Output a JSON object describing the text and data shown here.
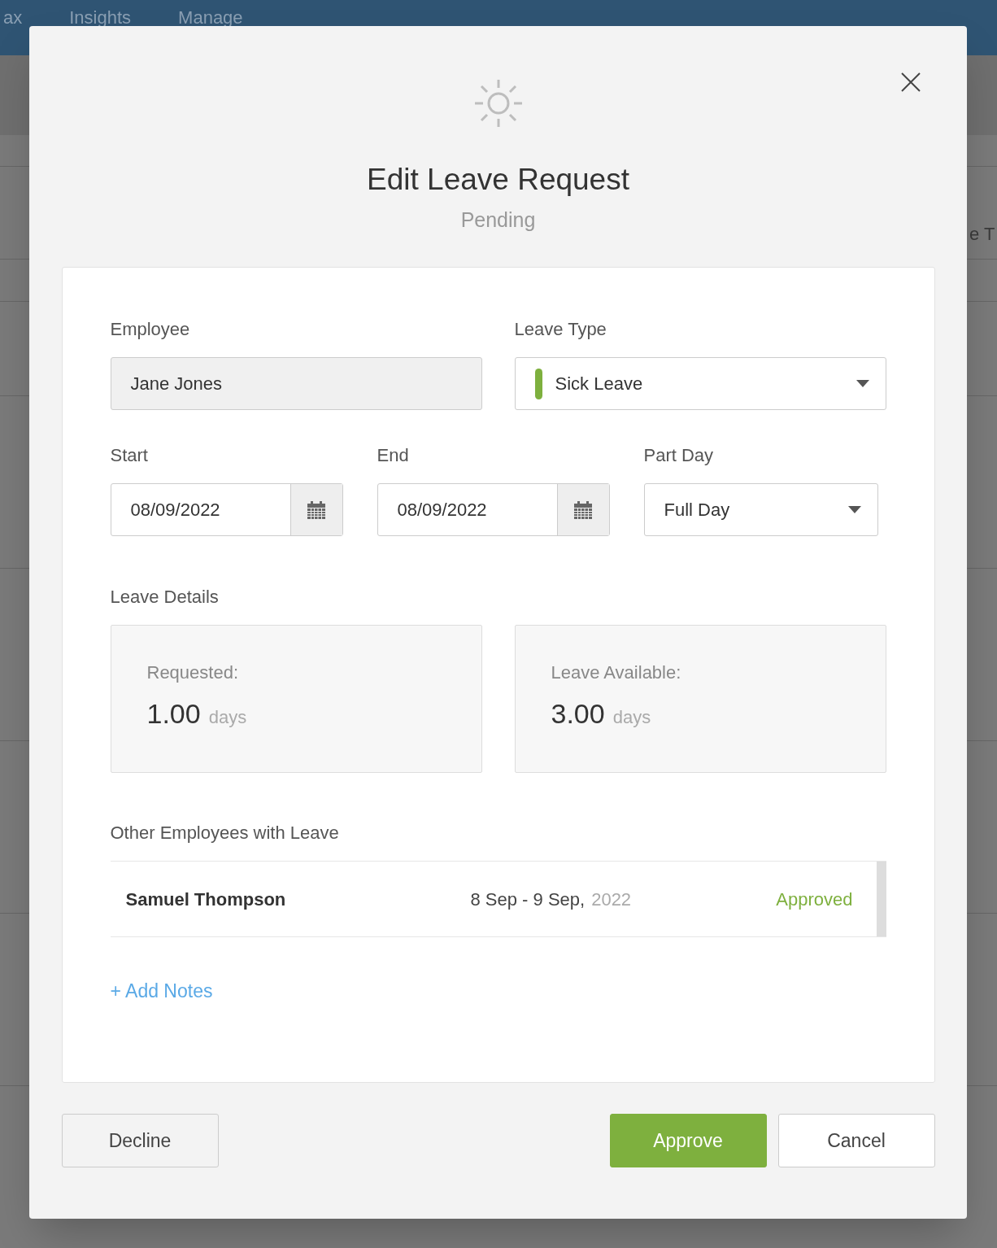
{
  "background": {
    "nav": [
      "ax",
      "Insights",
      "Manage"
    ],
    "column_header": "e T"
  },
  "dialog": {
    "title": "Edit Leave Request",
    "status": "Pending",
    "employee": {
      "label": "Employee",
      "value": "Jane Jones"
    },
    "leave_type": {
      "label": "Leave Type",
      "value": "Sick Leave",
      "color": "#7eb03e"
    },
    "start": {
      "label": "Start",
      "value": "08/09/2022"
    },
    "end": {
      "label": "End",
      "value": "08/09/2022"
    },
    "part_day": {
      "label": "Part Day",
      "value": "Full Day"
    },
    "leave_details": {
      "label": "Leave Details",
      "cards": [
        {
          "label": "Requested:",
          "amount": "1.00",
          "unit": "days"
        },
        {
          "label": "Leave Available:",
          "amount": "3.00",
          "unit": "days"
        }
      ]
    },
    "other_employees": {
      "label": "Other Employees with Leave",
      "rows": [
        {
          "name": "Samuel Thompson",
          "dates": "8 Sep - 9 Sep,",
          "year": "2022",
          "status": "Approved"
        }
      ]
    },
    "add_notes": "+ Add Notes",
    "buttons": [
      {
        "label": "Decline",
        "kind": "secondary"
      },
      {
        "label": "Approve",
        "kind": "primary"
      },
      {
        "label": "Cancel",
        "kind": "plain"
      }
    ]
  }
}
